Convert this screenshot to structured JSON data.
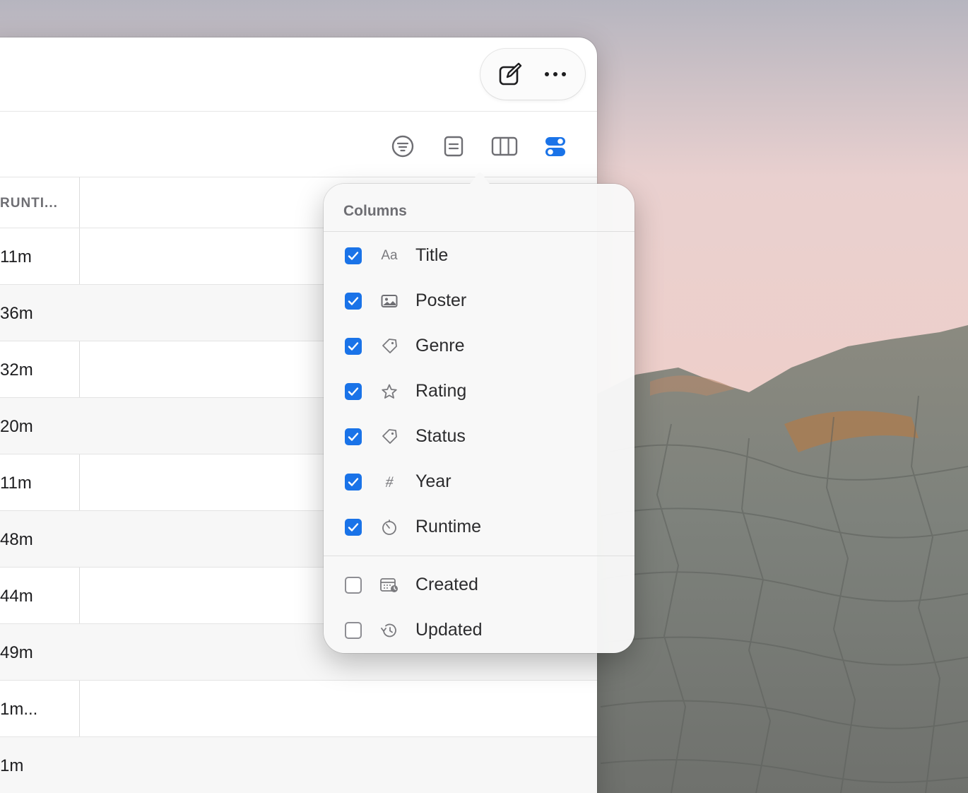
{
  "window": {
    "titlebar": {
      "icons": [
        "compose-icon",
        "more-icon"
      ]
    },
    "toolbar": {
      "icons": [
        "filter-icon",
        "list-icon",
        "columns-icon",
        "toggles-icon"
      ],
      "accent_color": "#1a73e8"
    },
    "table": {
      "header_runtime": "RUNTI...",
      "rows": [
        "11m",
        "36m",
        "32m",
        "20m",
        "11m",
        "48m",
        "44m",
        "49m",
        "1m...",
        "1m"
      ]
    }
  },
  "popover": {
    "title": "Columns",
    "items": [
      {
        "label": "Title",
        "checked": true,
        "icon": "text-aa-icon"
      },
      {
        "label": "Poster",
        "checked": true,
        "icon": "image-icon"
      },
      {
        "label": "Genre",
        "checked": true,
        "icon": "tag-icon"
      },
      {
        "label": "Rating",
        "checked": true,
        "icon": "star-icon"
      },
      {
        "label": "Status",
        "checked": true,
        "icon": "tag-icon"
      },
      {
        "label": "Year",
        "checked": true,
        "icon": "hash-icon"
      },
      {
        "label": "Runtime",
        "checked": true,
        "icon": "timer-icon"
      },
      {
        "label": "Created",
        "checked": false,
        "icon": "calendar-clock-icon"
      },
      {
        "label": "Updated",
        "checked": false,
        "icon": "history-icon"
      }
    ]
  }
}
